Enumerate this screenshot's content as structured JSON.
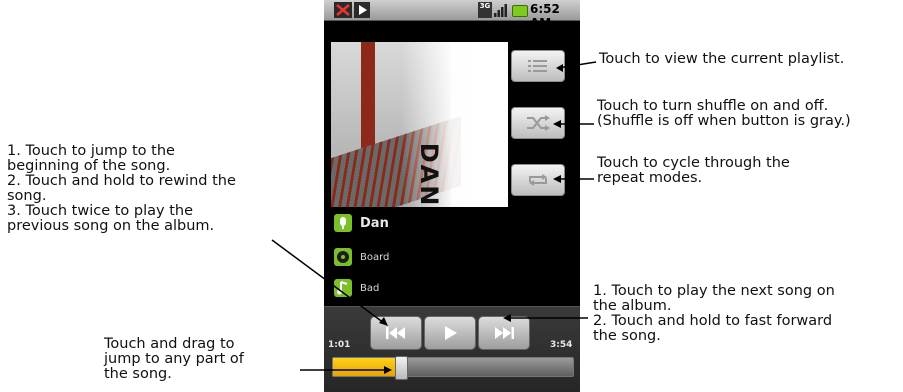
{
  "callouts": {
    "playlist": "Touch to view the current playlist.",
    "shuffle": "Touch to turn shuffle on and off.\n(Shuffle is off when button is gray.)",
    "repeat": "Touch to cycle through the\nrepeat modes.",
    "previous": "1. Touch to jump to the\nbeginning of the song.\n2. Touch and hold to rewind the\nsong.\n3. Touch twice to play the\nprevious song on the album.",
    "next": "1. Touch to play the next song on\nthe album.\n2. Touch and hold to fast forward\nthe song.",
    "seek": "Touch and drag to\njump to any part of\nthe song."
  },
  "status_bar": {
    "time": "6:52 AM",
    "network": "3G",
    "icons": [
      "missed-call-icon",
      "now-playing-icon",
      "3g-icon",
      "signal-icon",
      "battery-icon"
    ]
  },
  "album_art": {
    "title_text": "DAN"
  },
  "track": {
    "artist": "Dan",
    "album": "Board",
    "song": "Bad"
  },
  "side_buttons": {
    "icons": [
      "playlist-icon",
      "shuffle-icon",
      "repeat-icon"
    ],
    "shuffle_state": "off"
  },
  "playback": {
    "elapsed": "1:01",
    "total": "3:54",
    "progress_fraction": 0.26
  },
  "colors": {
    "accent_green": "#7bbf2a",
    "progress_yellow": "#f5b800",
    "battery_green": "#7dcb1f"
  }
}
